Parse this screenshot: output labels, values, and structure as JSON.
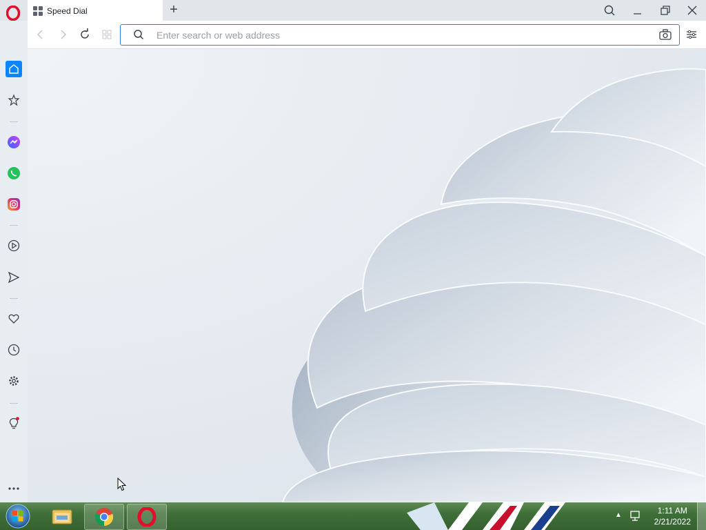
{
  "browser": {
    "tab": {
      "title": "Speed Dial"
    },
    "address_bar": {
      "placeholder": "Enter search or web address",
      "value": ""
    }
  },
  "sidebar": {
    "items": [
      "home",
      "bookmarks",
      "messenger",
      "whatsapp",
      "instagram",
      "player",
      "flow",
      "pinboards",
      "history",
      "settings",
      "tips",
      "more"
    ]
  },
  "taskbar": {
    "clock": {
      "time": "1:11 AM",
      "date": "2/21/2022"
    },
    "apps": [
      "windows-explorer",
      "chrome",
      "opera"
    ]
  },
  "colors": {
    "accent": "#0a84ff",
    "opera_red": "#e0102a"
  }
}
